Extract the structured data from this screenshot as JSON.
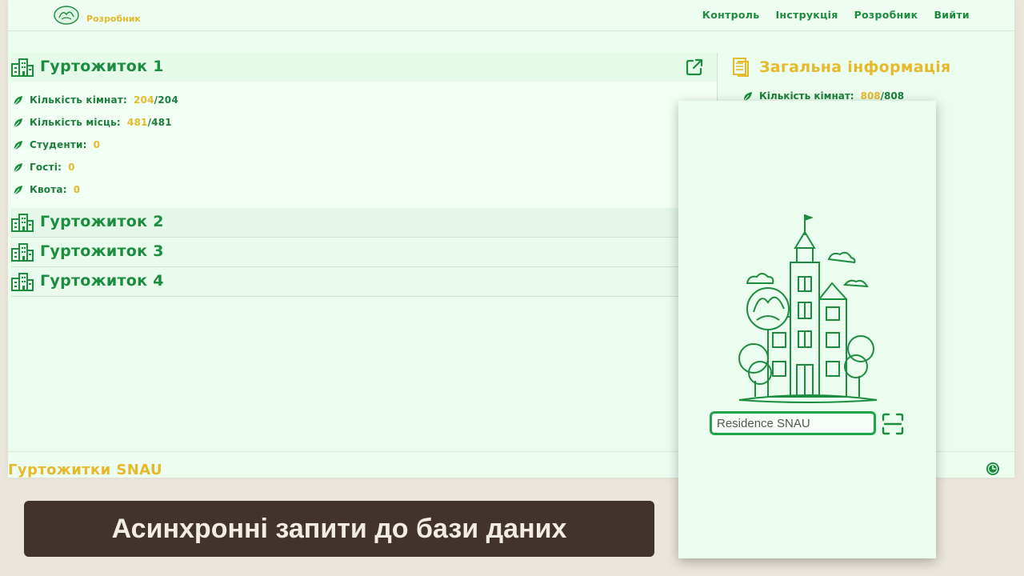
{
  "header": {
    "brand": "Розробник",
    "nav": [
      "Контроль",
      "Інструкція",
      "Розробник",
      "Вийти"
    ]
  },
  "dorms": [
    {
      "title": "Гуртожиток 1",
      "expanded": true,
      "stats": [
        {
          "label": "Кількість кімнат:",
          "value": "204",
          "total": "/204"
        },
        {
          "label": "Кількість місць:",
          "value": "481",
          "total": "/481"
        },
        {
          "label": "Студенти:",
          "value": "0",
          "total": ""
        },
        {
          "label": "Гості:",
          "value": "0",
          "total": ""
        },
        {
          "label": "Квота:",
          "value": "0",
          "total": ""
        }
      ]
    },
    {
      "title": "Гуртожиток 2",
      "expanded": false
    },
    {
      "title": "Гуртожиток 3",
      "expanded": false
    },
    {
      "title": "Гуртожиток 4",
      "expanded": false
    }
  ],
  "general_info": {
    "title": "Загальна інформація",
    "rooms_label": "Кількість кімнат:",
    "rooms_value": "808",
    "rooms_total": "/808"
  },
  "footer": {
    "brand": "Гуртожитки SNAU"
  },
  "phone": {
    "input_value": "Residence SNAU"
  },
  "caption": "Асинхронні запити до бази даних",
  "colors": {
    "green": "#1c8c3f",
    "gold": "#e5b92a",
    "background": "#ebfdee",
    "caption_bg": "#43332f"
  },
  "icons": [
    "building-icon",
    "external-link-icon",
    "leaf-icon",
    "document-icon",
    "clock-icon",
    "scan-icon",
    "logo"
  ]
}
